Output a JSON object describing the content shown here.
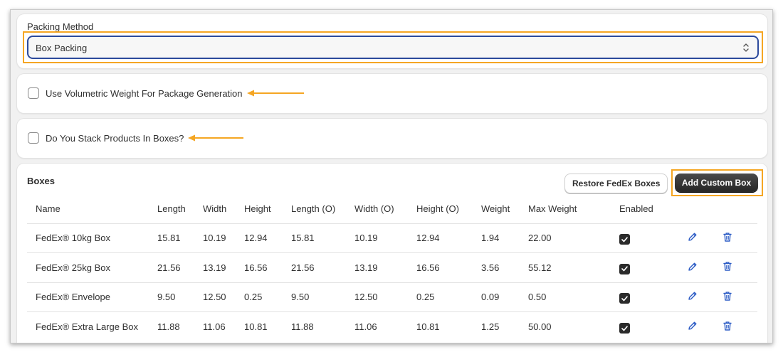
{
  "packing": {
    "label": "Packing Method",
    "value": "Box Packing"
  },
  "options": {
    "volumetric_label": "Use Volumetric Weight For Package Generation",
    "stack_label": "Do You Stack Products In Boxes?"
  },
  "boxes": {
    "title": "Boxes",
    "restore_label": "Restore FedEx Boxes",
    "add_label": "Add Custom Box",
    "columns": [
      "Name",
      "Length",
      "Width",
      "Height",
      "Length (O)",
      "Width (O)",
      "Height (O)",
      "Weight",
      "Max Weight",
      "Enabled"
    ],
    "rows": [
      [
        "FedEx® 10kg Box",
        "15.81",
        "10.19",
        "12.94",
        "15.81",
        "10.19",
        "12.94",
        "1.94",
        "22.00"
      ],
      [
        "FedEx® 25kg Box",
        "21.56",
        "13.19",
        "16.56",
        "21.56",
        "13.19",
        "16.56",
        "3.56",
        "55.12"
      ],
      [
        "FedEx® Envelope",
        "9.50",
        "12.50",
        "0.25",
        "9.50",
        "12.50",
        "0.25",
        "0.09",
        "0.50"
      ],
      [
        "FedEx® Extra Large Box",
        "11.88",
        "11.06",
        "10.81",
        "11.88",
        "11.06",
        "10.81",
        "1.25",
        "50.00"
      ]
    ],
    "enabled": [
      true,
      true,
      true,
      true
    ]
  },
  "colors": {
    "highlight": "#f5a623",
    "action_icon": "#2c5cc5",
    "primary_button": "#303030"
  },
  "icons": {
    "select": "chevron-up-down-icon",
    "edit": "pencil-icon",
    "delete": "trash-icon",
    "annotation": "arrow-left-icon"
  }
}
